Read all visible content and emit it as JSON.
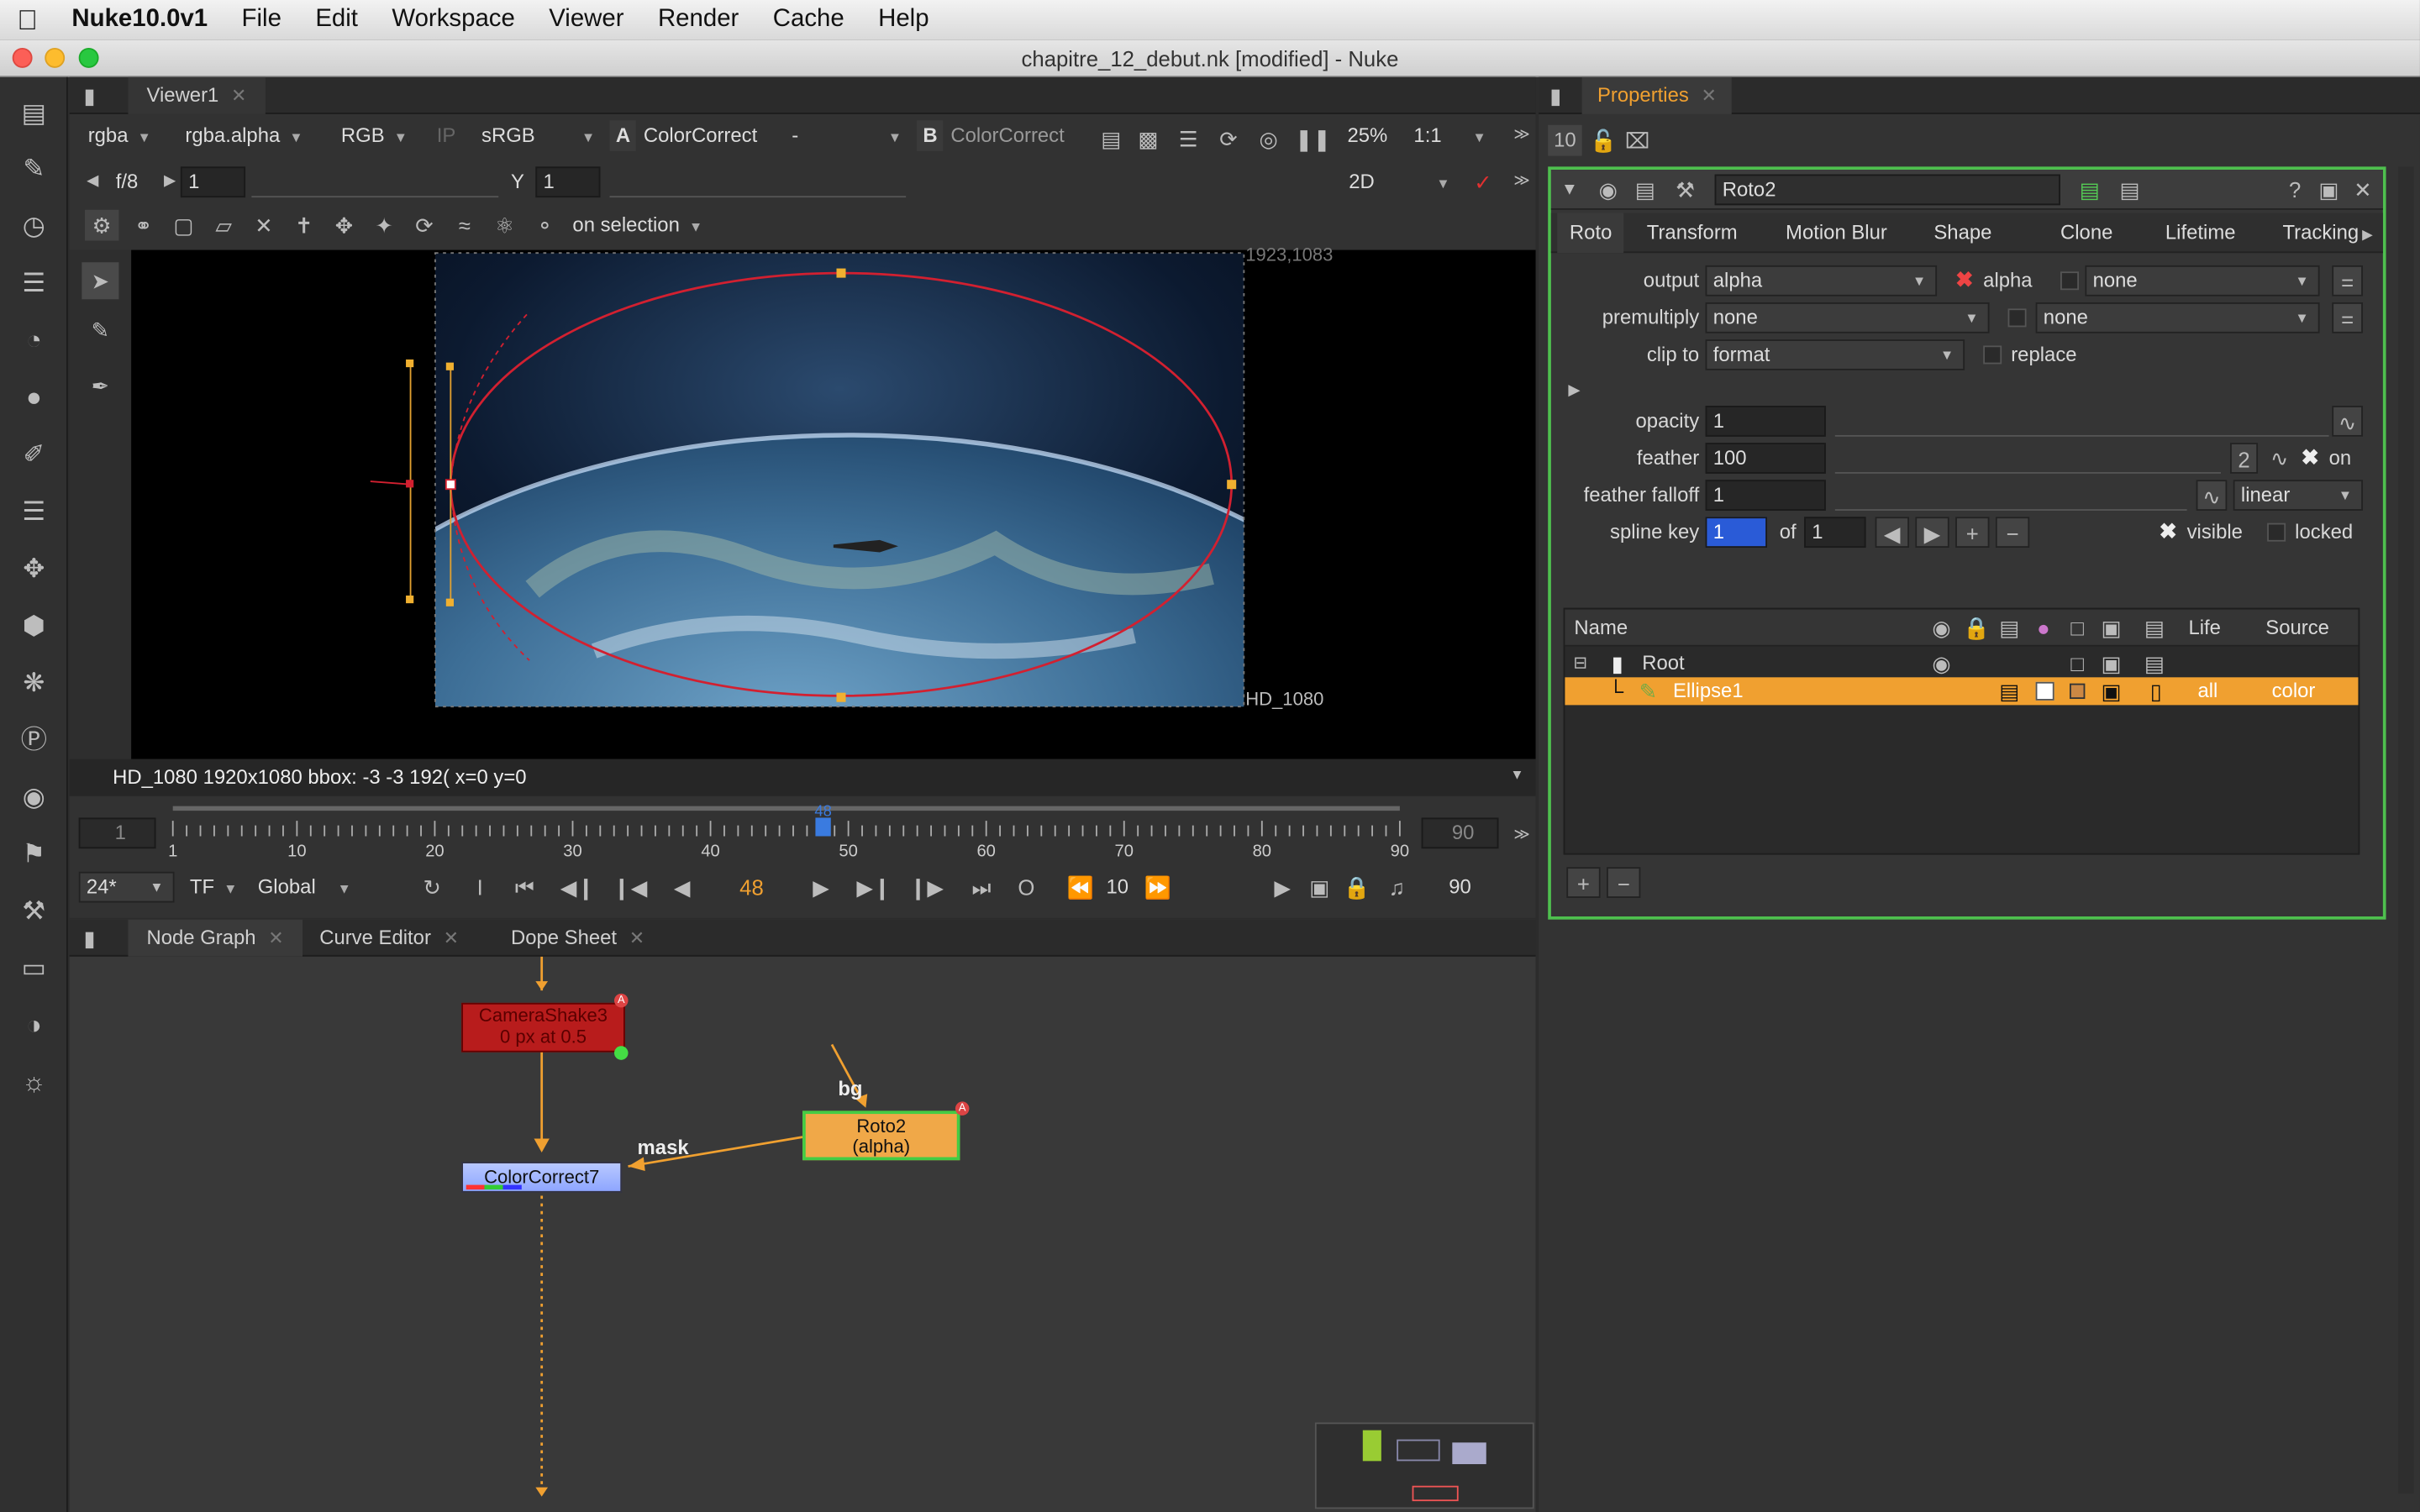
{
  "menu": {
    "app": "Nuke10.0v1",
    "items": [
      "File",
      "Edit",
      "Workspace",
      "Viewer",
      "Render",
      "Cache",
      "Help"
    ]
  },
  "window_title": "chapitre_12_debut.nk [modified] - Nuke",
  "viewer": {
    "tab": "Viewer1",
    "channels": "rgba",
    "channel_layer": "rgba.alpha",
    "display": "RGB",
    "ip": "IP",
    "lut": "sRGB",
    "input_a_label": "A",
    "input_a": "ColorCorrect",
    "input_a_op": "-",
    "input_b_label": "B",
    "input_b": "ColorCorrect",
    "zoom": "25%",
    "ratio": "1:1",
    "fstop": "f/8",
    "gain": "1",
    "y_label": "Y",
    "gamma": "1",
    "view_mode": "2D",
    "roto_mode": "on selection",
    "corner_top": "1923,1083",
    "corner_bottom": "HD_1080",
    "info": "HD_1080 1920x1080  bbox: -3 -3 192( x=0 y=0"
  },
  "timeline": {
    "start": "1",
    "end": "90",
    "ticks": [
      "1",
      "10",
      "20",
      "30",
      "40",
      "50",
      "60",
      "70",
      "80",
      "90"
    ],
    "current_frame_marker": "48",
    "fps": "24*",
    "tf": "TF",
    "scope": "Global",
    "frame": "48",
    "increment": "10",
    "end_frame": "90",
    "frame_fraction": 0.53
  },
  "nodegraph": {
    "tabs": [
      "Node Graph",
      "Curve Editor",
      "Dope Sheet"
    ],
    "nodes": {
      "camera_shake_title": "CameraShake3",
      "camera_shake_sub": "0 px at 0.5",
      "color_correct": "ColorCorrect7",
      "roto_title": "Roto2",
      "roto_sub": "(alpha)"
    },
    "edge_labels": {
      "mask": "mask",
      "bg": "bg"
    }
  },
  "properties": {
    "tab": "Properties",
    "max_panels": "10",
    "node_name": "Roto2",
    "tabs": [
      "Roto",
      "Transform",
      "Motion Blur",
      "Shape",
      "Clone",
      "Lifetime",
      "Tracking"
    ],
    "output_label": "output",
    "output": "alpha",
    "output_alpha": "alpha",
    "output_second": "none",
    "premult_label": "premultiply",
    "premult": "none",
    "premult_second": "none",
    "clip_label": "clip to",
    "clip": "format",
    "replace": "replace",
    "opacity_label": "opacity",
    "opacity": "1",
    "feather_label": "feather",
    "feather": "100",
    "feather_anim": "2",
    "feather_on": "on",
    "falloff_label": "feather falloff",
    "falloff": "1",
    "falloff_type": "linear",
    "spline_label": "spline key",
    "spline_key": "1",
    "of": "of",
    "spline_total": "1",
    "visible": "visible",
    "locked": "locked",
    "columns": {
      "name": "Name",
      "life": "Life",
      "source": "Source"
    },
    "rows": [
      {
        "name": "Root"
      },
      {
        "name": "Ellipse1",
        "life": "all",
        "source": "color"
      }
    ]
  },
  "colors": {
    "accent_orange": "#f0a030",
    "roto_green": "#44cc44",
    "node_red": "#b81c1c",
    "ellipse": "#d22030"
  }
}
